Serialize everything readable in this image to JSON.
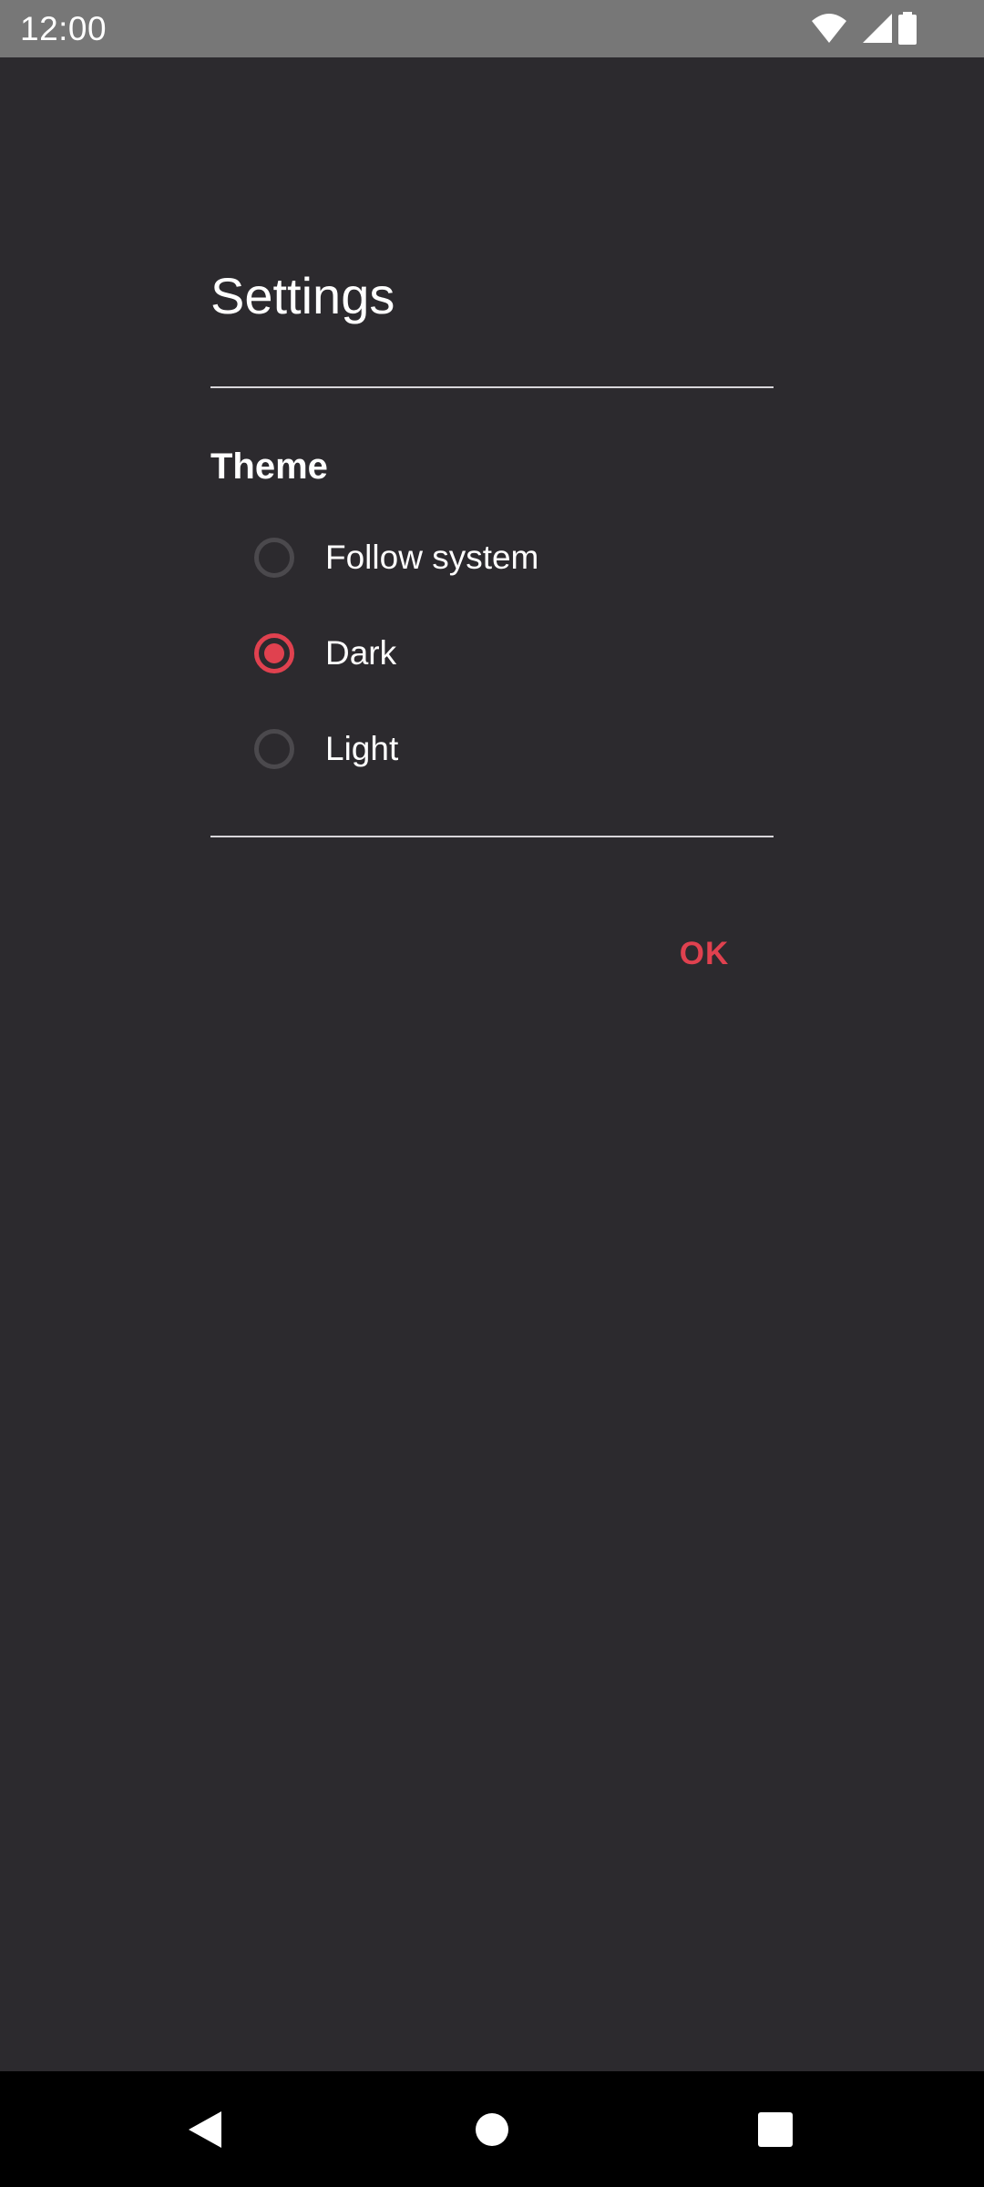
{
  "status_bar": {
    "time": "12:00",
    "icons": [
      "wifi-icon",
      "cell-signal-icon",
      "battery-icon"
    ]
  },
  "dialog": {
    "title": "Settings",
    "section_title": "Theme",
    "options": [
      {
        "label": "Follow system",
        "selected": false
      },
      {
        "label": "Dark",
        "selected": true
      },
      {
        "label": "Light",
        "selected": false
      }
    ],
    "ok_label": "OK"
  },
  "nav_bar": {
    "icons": [
      "back-icon",
      "home-icon",
      "recents-icon"
    ]
  },
  "colors": {
    "background": "#2c2a2e",
    "accent": "#e0414f",
    "status_bar": "#777777",
    "nav_bar": "#000000",
    "divider": "#d8d6da"
  }
}
